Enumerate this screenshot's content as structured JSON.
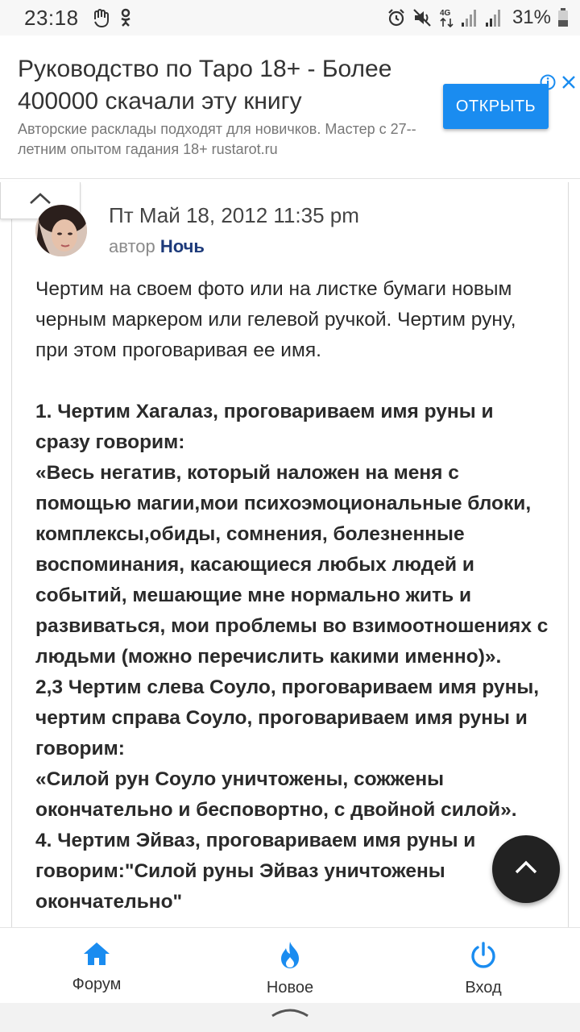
{
  "status_bar": {
    "time": "23:18",
    "battery": "31%",
    "network": "4G",
    "icons": [
      "hand-icon",
      "odnoklassniki-icon",
      "alarm-icon",
      "mute-icon",
      "signal-icon",
      "battery-icon"
    ]
  },
  "ad": {
    "title": "Руководство по Таро 18+ - Более 400000 скачали эту книгу",
    "description": "Авторские расклады подходят для новичков. Мастер с 27--летним опытом гадания 18+ rustarot.ru",
    "button_label": "ОТКРЫТЬ",
    "button_color": "#1a8cf0"
  },
  "post": {
    "date": "Пт Май 18, 2012 11:35 pm",
    "author_prefix": "автор",
    "author_name": "Ночь",
    "intro": "Чертим на своем фото или на листке бумаги новым черным маркером или гелевой ручкой. Чертим руну, при этом проговаривая ее имя.",
    "paragraphs": [
      "1. Чертим Хагалаз, проговариваем имя руны и сразу говорим:",
      "«Весь негатив, который наложен на меня с помощью магии,мои психоэмоциональные блоки, комплексы,обиды, сомнения, болезненные воспоминания, касающиеся любых людей и событий, мешающие мне нормально жить и развиваться, мои проблемы во взимоотношениях с людьми (можно перечислить какими именно)».",
      "2,3 Чертим слева Соуло, проговариваем имя руны, чертим справа Соуло, проговариваем имя руны и говорим:",
      "«Силой рун Соуло уничтожены, сожжены окончательно и бесповортно, с двойной силой».",
      "4. Чертим Эйваз, проговариваем имя руны и говорим:\"Силой руны Эйваз уничтожены окончательно\""
    ]
  },
  "bottom_nav": {
    "items": [
      {
        "label": "Форум",
        "icon": "home-icon"
      },
      {
        "label": "Новое",
        "icon": "flame-icon"
      },
      {
        "label": "Вход",
        "icon": "power-icon"
      }
    ],
    "accent": "#1a8cf0"
  }
}
